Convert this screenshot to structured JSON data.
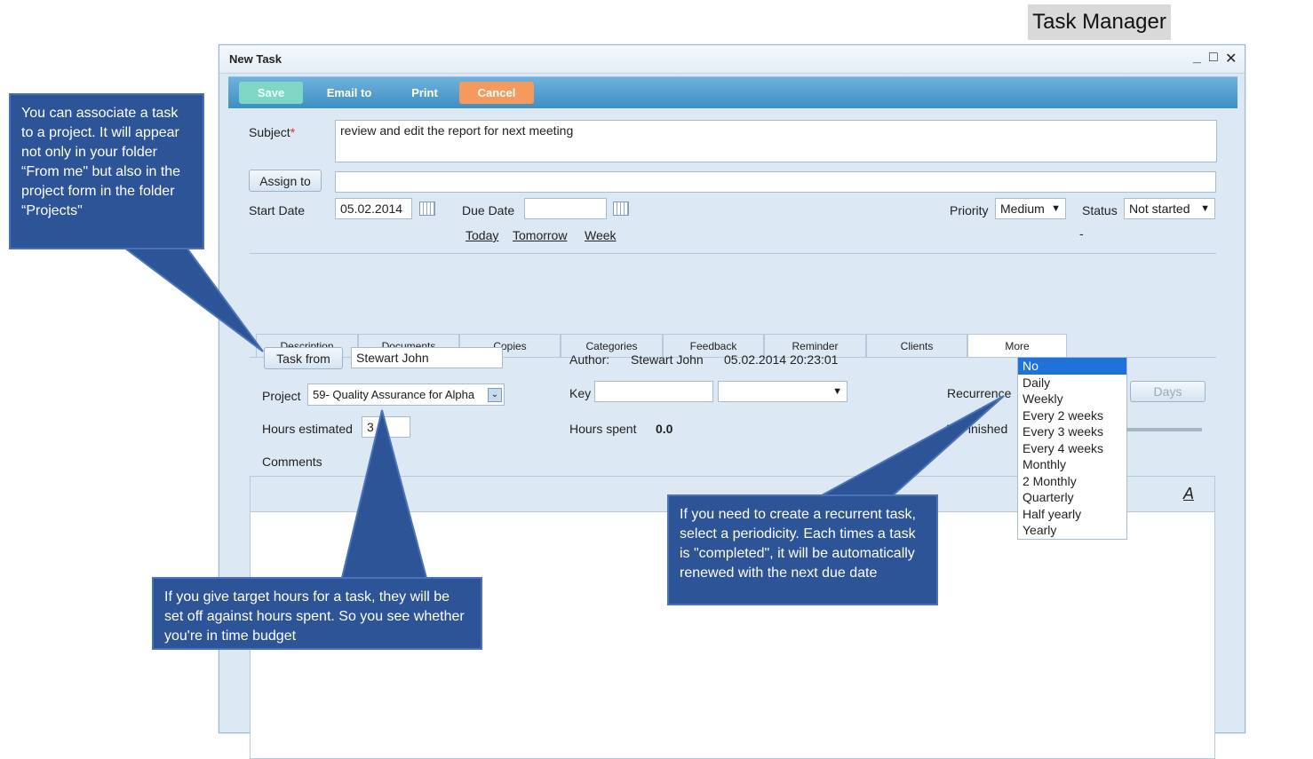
{
  "banner": "Task Manager",
  "window": {
    "title": "New Task",
    "controls": {
      "minimize": "_",
      "maximize": "□",
      "close": "✕"
    }
  },
  "toolbar": {
    "save": "Save",
    "email": "Email to",
    "print": "Print",
    "cancel": "Cancel"
  },
  "form": {
    "subject_label": "Subject",
    "required_mark": "*",
    "subject_value": "review and edit the report for next meeting",
    "assign_button": "Assign to",
    "assign_value": "",
    "start_date_label": "Start Date",
    "start_date_value": "05.02.2014",
    "due_date_label": "Due Date",
    "due_date_value": "",
    "quick_links": [
      "Today",
      "Tomorrow",
      "Week"
    ],
    "priority_label": "Priority",
    "priority_value": "Medium",
    "status_label": "Status",
    "status_value": "Not started",
    "dash": "-"
  },
  "tabs": [
    "Description",
    "Documents",
    "Copies",
    "Categories",
    "Feedback",
    "Reminder",
    "Clients",
    "More"
  ],
  "active_tab": "More",
  "more": {
    "task_from_button": "Task from",
    "task_from_value": "Stewart John",
    "author_label": "Author:",
    "author_value": "Stewart John",
    "author_date": "05.02.2014 20:23:01",
    "project_label": "Project",
    "project_value": "59- Quality Assurance for Alpha",
    "key_label": "Key",
    "key_value": "",
    "key_select_value": "",
    "recurrence_label": "Recurrence",
    "recurrence_value": "No",
    "days_button": "Days",
    "hours_estimated_label": "Hours estimated",
    "hours_estimated_value": "3",
    "hours_spent_label": "Hours spent",
    "hours_spent_value": "0.0",
    "finished_label": "% Finished",
    "comments_label": "Comments",
    "font_icon_label": "A"
  },
  "recurrence_options": [
    "No",
    "Daily",
    "Weekly",
    "Every 2 weeks",
    "Every 3 weeks",
    "Every 4 weeks",
    "Monthly",
    "2 Monthly",
    "Quarterly",
    "Half yearly",
    "Yearly"
  ],
  "callouts": {
    "project": "You can associate a task to a project. It will appear not only in your folder “From me\" but also in the project form in the folder “Projects\"",
    "hours": "If you give target hours for a task, they will be set off against hours spent. So you see whether you're in time budget",
    "recurrence": "If you need to create a recurrent task, select a periodicity. Each times a task is \"completed\", it will be automatically renewed with the next due date"
  },
  "colors": {
    "callout_bg": "#2d5496",
    "toolbar": "#3f8fc3",
    "save": "#7fd6c5",
    "cancel": "#f59a5c",
    "selected": "#1e72d8"
  }
}
